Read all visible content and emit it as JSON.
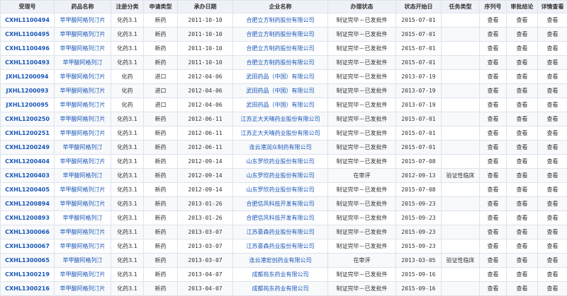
{
  "headers": [
    "受理号",
    "药品名称",
    "注册分类",
    "申请类型",
    "承办日期",
    "企业名称",
    "办理状态",
    "状态开始日",
    "任务类型",
    "序列号",
    "审批结论",
    "详情查看"
  ],
  "rows": [
    {
      "id": "CXHL1100494",
      "drug": "苹甲酸阿格列汀片",
      "cat": "化药3.1",
      "type": "新药",
      "date": "2011-10-10",
      "company": "合肥立方制药股份有限公司",
      "status": "制证完毕－已发批件",
      "start": "2015-07-01",
      "task": "",
      "seq": "查看",
      "conclusion": "查看",
      "detail": "查看"
    },
    {
      "id": "CXHL1100495",
      "drug": "苹甲酸阿格列汀片",
      "cat": "化药3.1",
      "type": "新药",
      "date": "2011-10-10",
      "company": "合肥立方制药股份有限公司",
      "status": "制证完毕－已发批件",
      "start": "2015-07-01",
      "task": "",
      "seq": "查看",
      "conclusion": "查看",
      "detail": "查看"
    },
    {
      "id": "CXHL1100496",
      "drug": "苹甲酸阿格列汀片",
      "cat": "化药3.1",
      "type": "新药",
      "date": "2011-10-10",
      "company": "合肥立方制药股份有限公司",
      "status": "制证完毕－已发批件",
      "start": "2015-07-01",
      "task": "",
      "seq": "查看",
      "conclusion": "查看",
      "detail": "查看"
    },
    {
      "id": "CXHL1100493",
      "drug": "苹甲酸阿格列汀",
      "cat": "化药3.1",
      "type": "新药",
      "date": "2011-10-10",
      "company": "合肥立方制药股份有限公司",
      "status": "制证完毕－已发批件",
      "start": "2015-07-01",
      "task": "",
      "seq": "查看",
      "conclusion": "查看",
      "detail": "查看"
    },
    {
      "id": "JXHL1200094",
      "drug": "苹甲酸阿格列汀片",
      "cat": "化药",
      "type": "进口",
      "date": "2012-04-06",
      "company": "武田药品（中国）有限公司",
      "status": "制证完毕－已发批件",
      "start": "2013-07-19",
      "task": "",
      "seq": "查看",
      "conclusion": "查看",
      "detail": "查看"
    },
    {
      "id": "JXHL1200093",
      "drug": "苹甲酸阿格列汀片",
      "cat": "化药",
      "type": "进口",
      "date": "2012-04-06",
      "company": "武田药品（中国）有限公司",
      "status": "制证完毕－已发批件",
      "start": "2013-07-19",
      "task": "",
      "seq": "查看",
      "conclusion": "查看",
      "detail": "查看"
    },
    {
      "id": "JXHL1200095",
      "drug": "苹甲酸阿格列汀片",
      "cat": "化药",
      "type": "进口",
      "date": "2012-04-06",
      "company": "武田药品（中国）有限公司",
      "status": "制证完毕－已发批件",
      "start": "2013-07-19",
      "task": "",
      "seq": "查看",
      "conclusion": "查看",
      "detail": "查看"
    },
    {
      "id": "CXHL1200250",
      "drug": "苹甲酸阿格列汀片",
      "cat": "化药3.1",
      "type": "新药",
      "date": "2012-06-11",
      "company": "江苏正大天晴药业股份有限公司",
      "status": "制证完毕－已发批件",
      "start": "2015-07-01",
      "task": "",
      "seq": "查看",
      "conclusion": "查看",
      "detail": "查看"
    },
    {
      "id": "CXHL1200251",
      "drug": "苹甲酸阿格列汀片",
      "cat": "化药3.1",
      "type": "新药",
      "date": "2012-06-11",
      "company": "江苏正大天晴药业股份有限公司",
      "status": "制证完毕－已发批件",
      "start": "2015-07-01",
      "task": "",
      "seq": "查看",
      "conclusion": "查看",
      "detail": "查看"
    },
    {
      "id": "CXHL1200249",
      "drug": "苹甲酸阿格列汀",
      "cat": "化药3.1",
      "type": "新药",
      "date": "2012-06-11",
      "company": "连云港润众制药有限公司",
      "status": "制证完毕－已发批件",
      "start": "2015-07-01",
      "task": "",
      "seq": "查看",
      "conclusion": "查看",
      "detail": "查看"
    },
    {
      "id": "CXHL1200404",
      "drug": "苹甲酸阿格列汀片",
      "cat": "化药3.1",
      "type": "新药",
      "date": "2012-09-14",
      "company": "山东罗欣药业股份有限公司",
      "status": "制证完毕－已发批件",
      "start": "2015-07-08",
      "task": "",
      "seq": "查看",
      "conclusion": "查看",
      "detail": "查看"
    },
    {
      "id": "CXHL1200403",
      "drug": "苹甲酸阿格列汀",
      "cat": "化药3.1",
      "type": "新药",
      "date": "2012-09-14",
      "company": "山东罗欣药业股份有限公司",
      "status": "在审评",
      "start": "2012-09-13",
      "task": "验证性临床",
      "seq": "查看",
      "conclusion": "查看",
      "detail": "查看"
    },
    {
      "id": "CXHL1200405",
      "drug": "苹甲酸阿格列汀片",
      "cat": "化药3.1",
      "type": "新药",
      "date": "2012-09-14",
      "company": "山东罗欣药业股份有限公司",
      "status": "制证完毕－已发批件",
      "start": "2015-07-08",
      "task": "",
      "seq": "查看",
      "conclusion": "查看",
      "detail": "查看"
    },
    {
      "id": "CXHL1200894",
      "drug": "苹甲酸阿格列汀片",
      "cat": "化药3.1",
      "type": "新药",
      "date": "2013-01-26",
      "company": "合肥信风科技开发有限公司",
      "status": "制证完毕－已发批件",
      "start": "2015-09-23",
      "task": "",
      "seq": "查看",
      "conclusion": "查看",
      "detail": "查看"
    },
    {
      "id": "CXHL1200893",
      "drug": "苹甲酸阿格列汀",
      "cat": "化药3.1",
      "type": "新药",
      "date": "2013-01-26",
      "company": "合肥信风科技开发有限公司",
      "status": "制证完毕－已发批件",
      "start": "2015-09-23",
      "task": "",
      "seq": "查看",
      "conclusion": "查看",
      "detail": "查看"
    },
    {
      "id": "CXHL1300066",
      "drug": "苹甲酸阿格列汀片",
      "cat": "化药3.1",
      "type": "新药",
      "date": "2013-03-07",
      "company": "江苏豪森药业股份有限公司",
      "status": "制证完毕－已发批件",
      "start": "2015-09-23",
      "task": "",
      "seq": "查看",
      "conclusion": "查看",
      "detail": "查看"
    },
    {
      "id": "CXHL1300067",
      "drug": "苹甲酸阿格列汀片",
      "cat": "化药3.1",
      "type": "新药",
      "date": "2013-03-07",
      "company": "江苏豪森药业股份有限公司",
      "status": "制证完毕－已发批件",
      "start": "2015-09-23",
      "task": "",
      "seq": "查看",
      "conclusion": "查看",
      "detail": "查看"
    },
    {
      "id": "CXHL1300065",
      "drug": "苹甲酸阿格列汀",
      "cat": "化药3.1",
      "type": "新药",
      "date": "2013-03-07",
      "company": "连云港宏创药业有限公司",
      "status": "在审评",
      "start": "2013-03-05",
      "task": "验证性临床",
      "seq": "查看",
      "conclusion": "查看",
      "detail": "查看"
    },
    {
      "id": "CXHL1300219",
      "drug": "苹甲酸阿格列汀片",
      "cat": "化药3.1",
      "type": "新药",
      "date": "2013-04-07",
      "company": "成都苑东药业有限公司",
      "status": "制证完毕－已发批件",
      "start": "2015-09-16",
      "task": "",
      "seq": "查看",
      "conclusion": "查看",
      "detail": "查看"
    },
    {
      "id": "CXHL1300216",
      "drug": "苹甲酸阿格列汀片",
      "cat": "化药3.1",
      "type": "新药",
      "date": "2013-04-07",
      "company": "成都苑东药业有限公司",
      "status": "制证完毕－已发批件",
      "start": "2015-09-16",
      "task": "",
      "seq": "查看",
      "conclusion": "查看",
      "detail": "查看"
    }
  ]
}
